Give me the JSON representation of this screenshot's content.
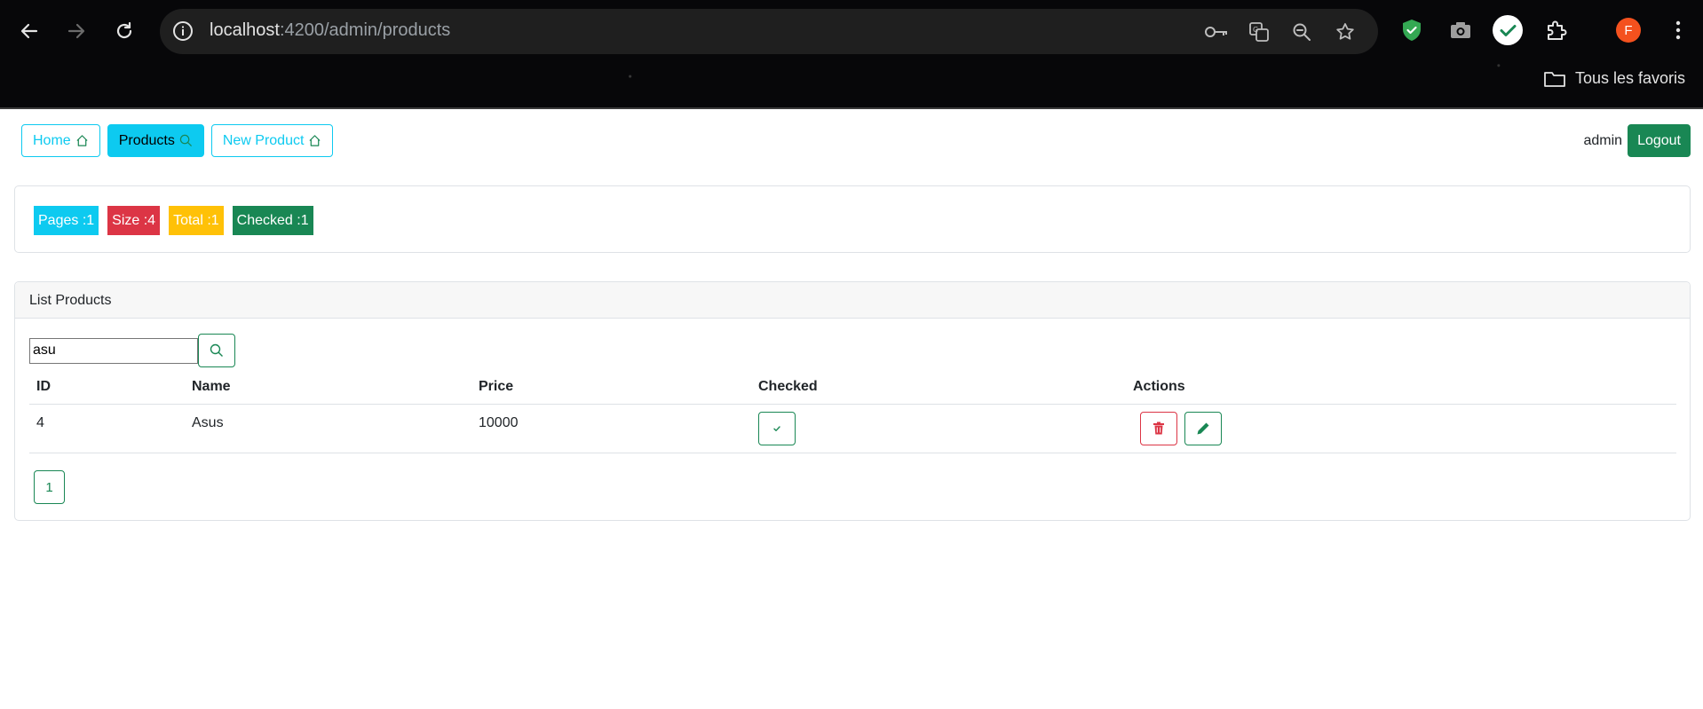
{
  "browser": {
    "url_host": "localhost",
    "url_path": ":4200/admin/products",
    "bookmarks_label": "Tous les favoris",
    "profile_initial": "F",
    "colors": {
      "profile": "#f4511e",
      "shield": "#34a853"
    }
  },
  "nav": {
    "home_label": "Home",
    "products_label": "Products",
    "new_product_label": "New Product"
  },
  "user": {
    "name": "admin",
    "logout_label": "Logout"
  },
  "stats": {
    "pages": "Pages :1",
    "size": "Size :4",
    "total": "Total :1",
    "checked": "Checked :1"
  },
  "products": {
    "header": "List Products",
    "search_value": "asu",
    "columns": [
      "ID",
      "Name",
      "Price",
      "Checked",
      "Actions"
    ],
    "rows": [
      {
        "id": "4",
        "name": "Asus",
        "price": "10000",
        "checked": true
      }
    ],
    "pagination": [
      "1"
    ]
  },
  "colors": {
    "info": "#0dcaf0",
    "danger": "#dc3545",
    "warning": "#ffc107",
    "success": "#198754"
  }
}
